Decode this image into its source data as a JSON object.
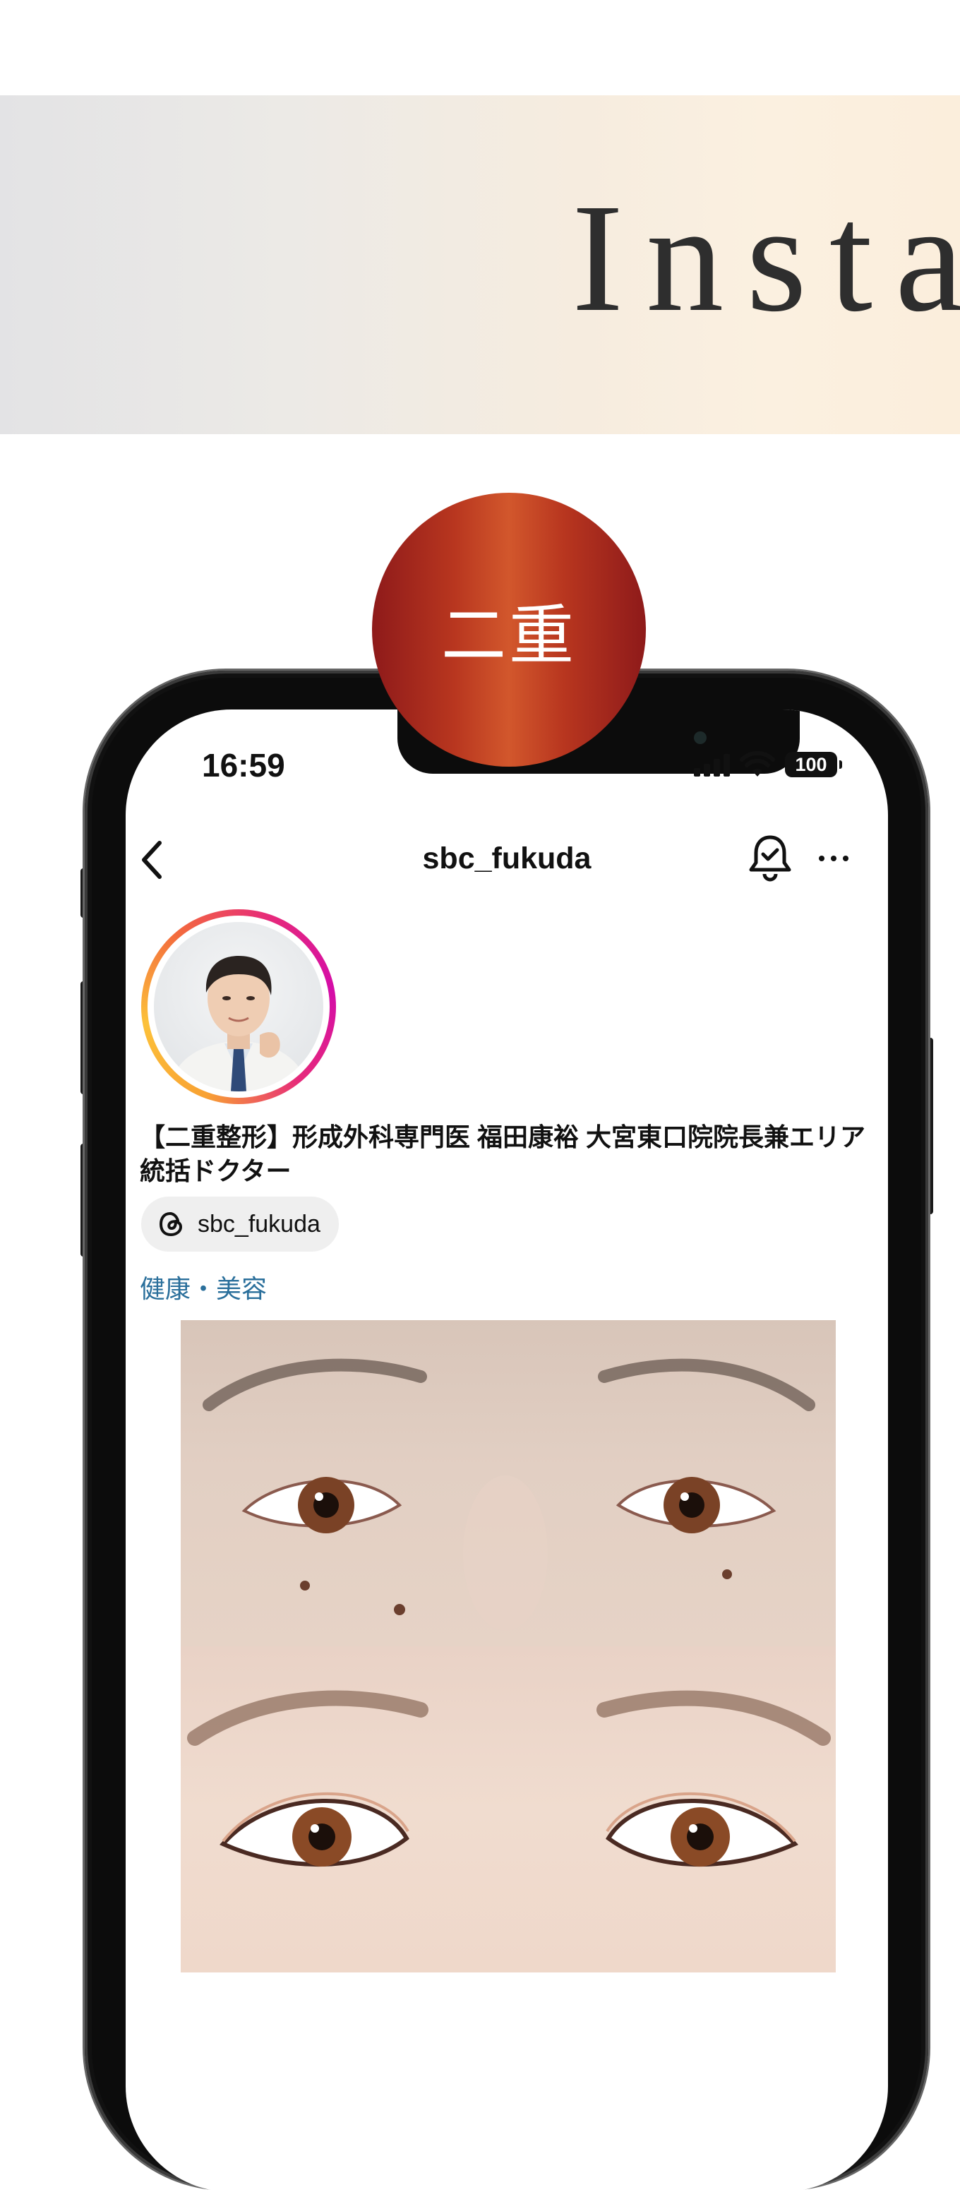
{
  "banner": {
    "title": "Insta"
  },
  "badge": {
    "label": "二重"
  },
  "status_bar": {
    "time": "16:59",
    "battery": "100"
  },
  "header": {
    "username": "sbc_fukuda"
  },
  "profile": {
    "bio_name": "【二重整形】形成外科専門医 福田康裕 大宮東口院院長兼エリア統括ドクター",
    "threads_handle": "sbc_fukuda",
    "category": "健康・美容"
  },
  "colors": {
    "banner_text": "#2e2e2e",
    "badge_red": "#b8361f",
    "category_link": "#2a6f9b"
  },
  "icons": [
    "back-chevron-icon",
    "bell-check-icon",
    "more-dots-icon",
    "threads-icon",
    "wifi-icon",
    "signal-icon",
    "battery-icon"
  ]
}
